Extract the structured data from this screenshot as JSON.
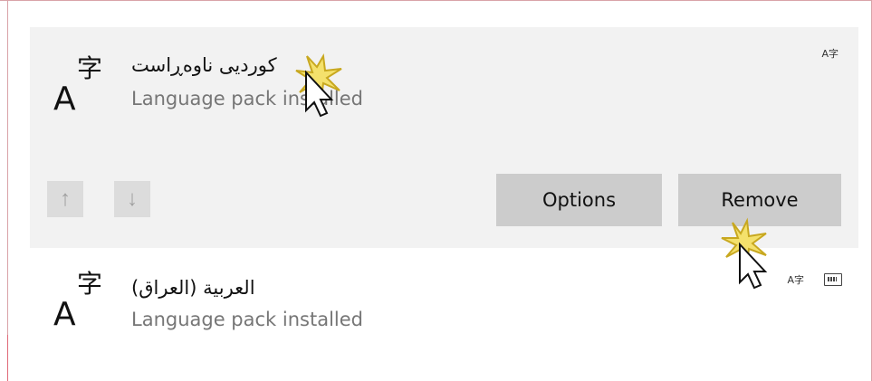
{
  "languages": [
    {
      "name": "كوردیی ناوەڕاست",
      "status": "Language pack installed",
      "icon": "language-icon",
      "selected": true,
      "feature_icons": [
        "language-feature-icon"
      ]
    },
    {
      "name": "العربية (العراق)",
      "status": "Language pack installed",
      "icon": "language-icon",
      "selected": false,
      "feature_icons": [
        "language-feature-icon",
        "keyboard-icon"
      ]
    }
  ],
  "controls": {
    "move_up_label": "↑",
    "move_down_label": "↓",
    "options_label": "Options",
    "remove_label": "Remove"
  },
  "colors": {
    "selected_background": "#f2f2f2",
    "button_background": "#cccccc",
    "secondary_text": "#767676",
    "frame": "#d9a3a8"
  }
}
